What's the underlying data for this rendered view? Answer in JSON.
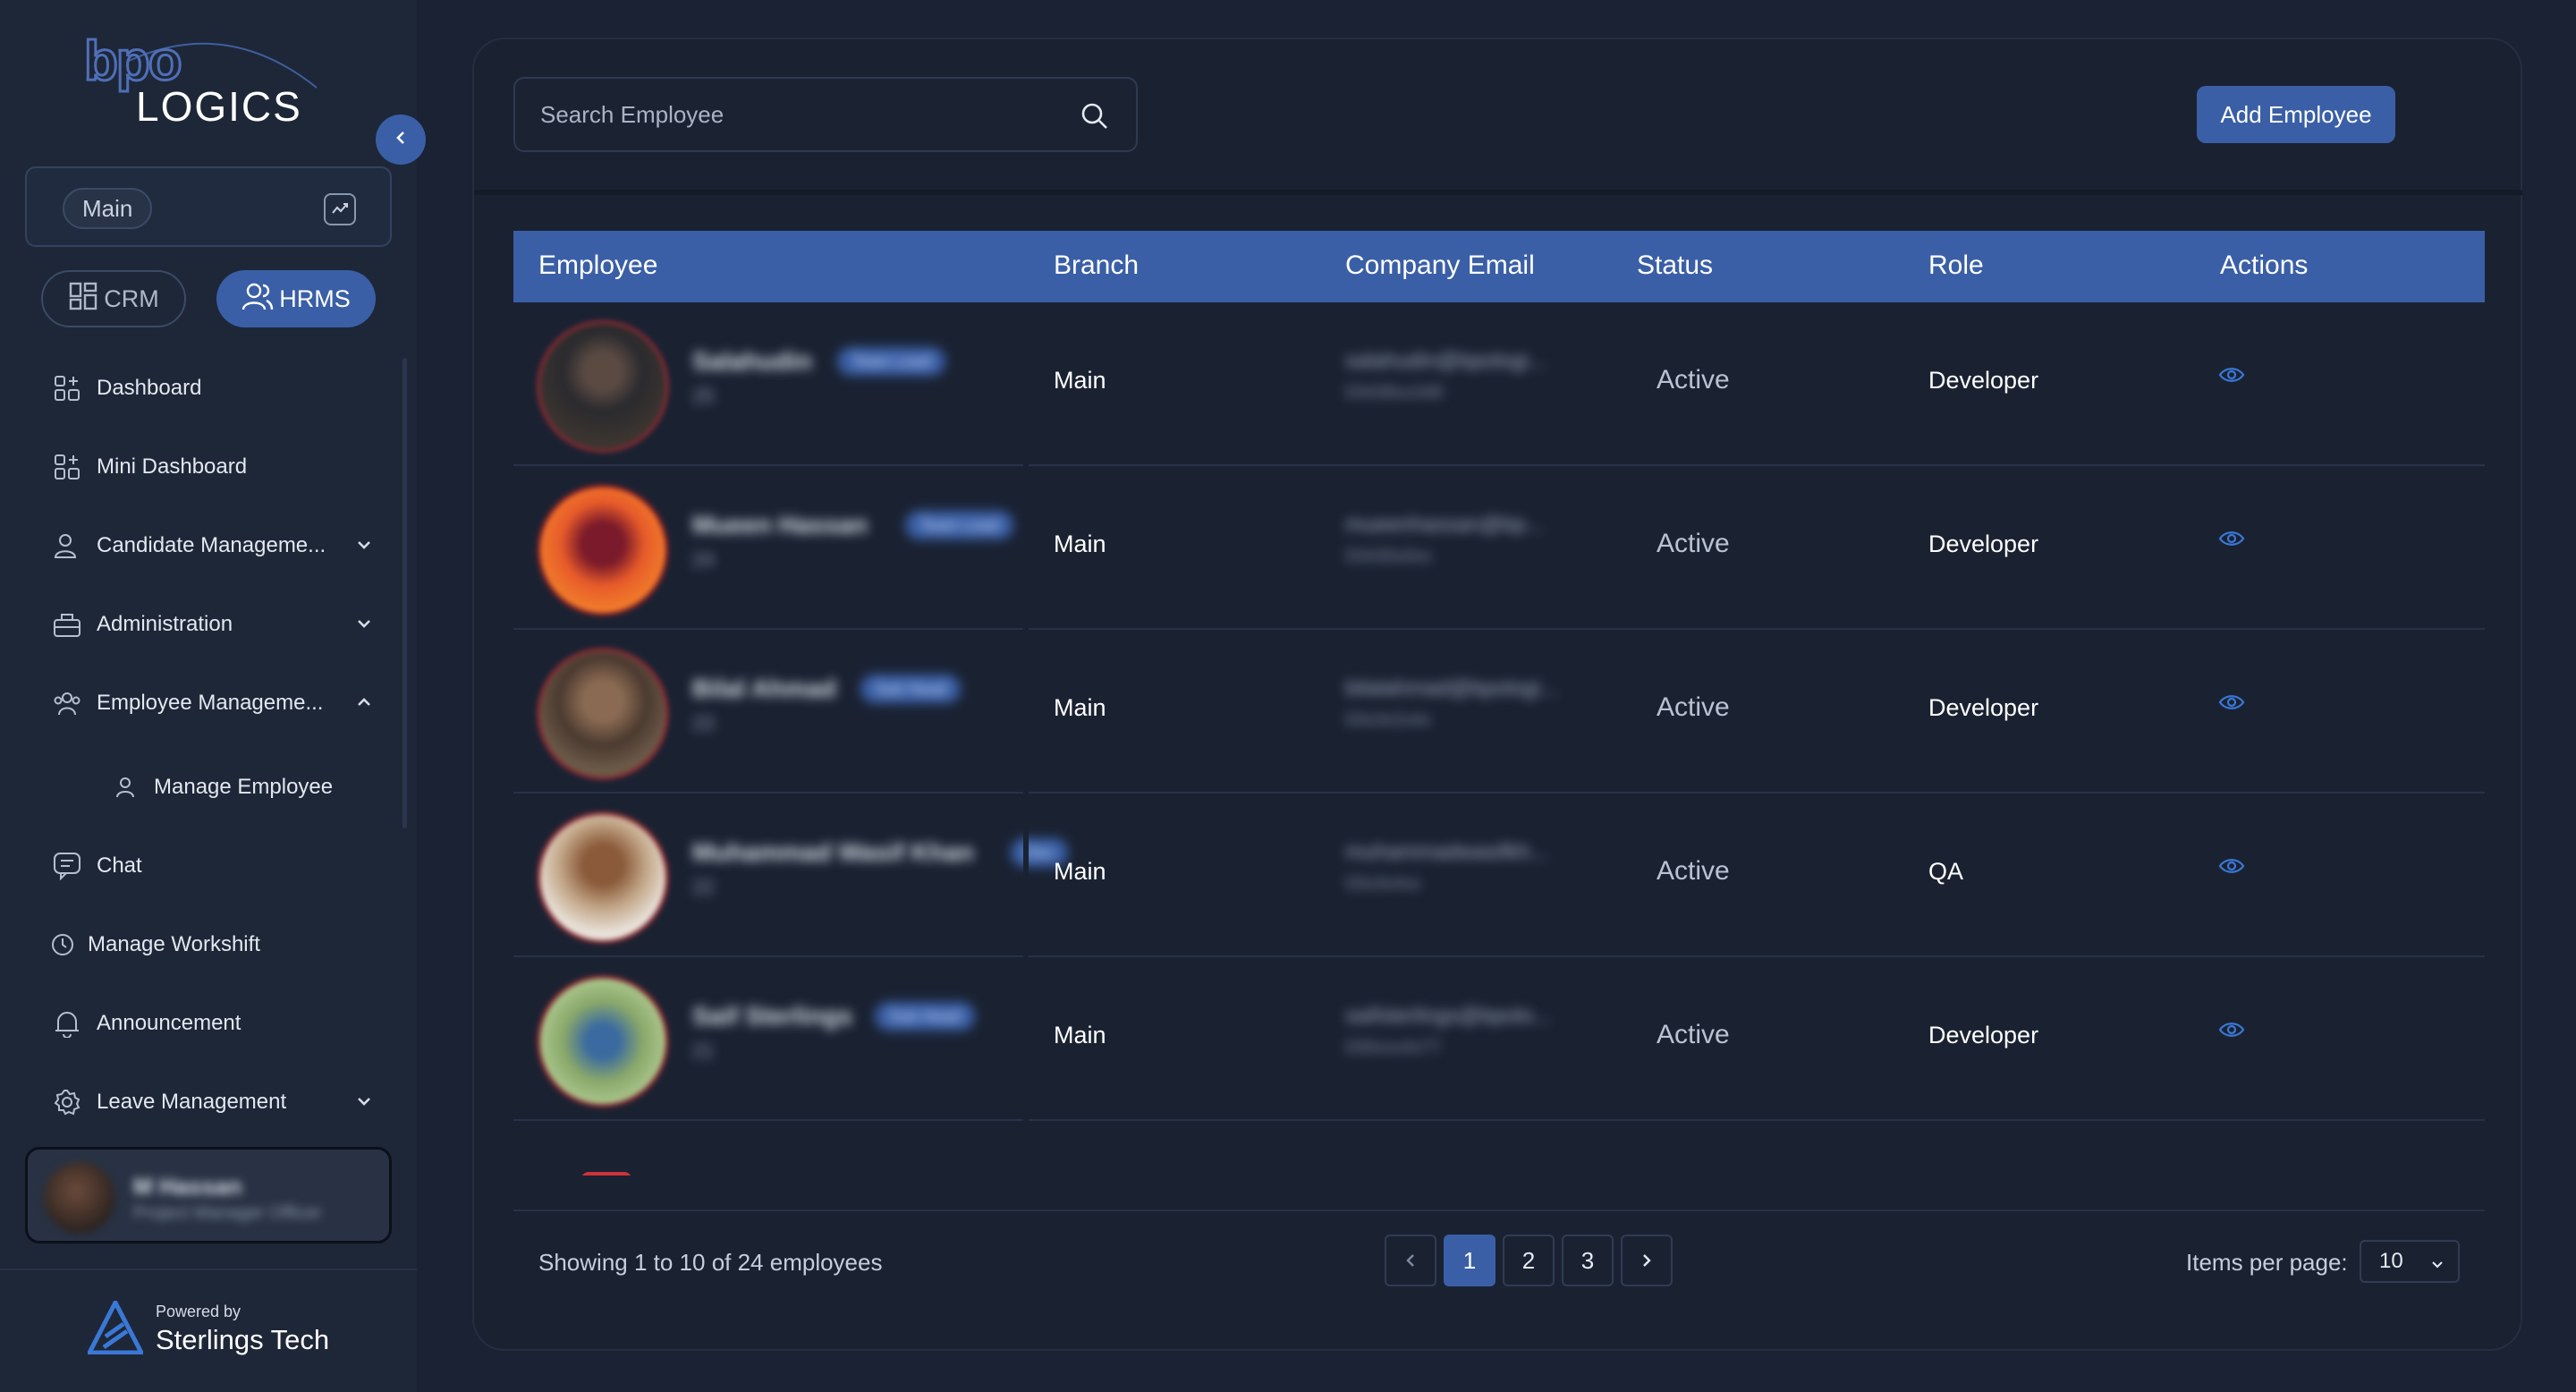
{
  "brand": {
    "top": "bpo",
    "bottom": "LOGICS"
  },
  "workspace": {
    "label": "Main"
  },
  "modules": {
    "crm": "CRM",
    "hrms": "HRMS"
  },
  "nav": [
    {
      "label": "Dashboard",
      "icon": "dashboard-icon"
    },
    {
      "label": "Mini Dashboard",
      "icon": "dashboard-icon"
    },
    {
      "label": "Candidate Manageme...",
      "icon": "users-icon",
      "expandable": true
    },
    {
      "label": "Administration",
      "icon": "briefcase-icon",
      "expandable": true
    },
    {
      "label": "Employee Manageme...",
      "icon": "team-icon",
      "expandable": true,
      "expanded": true
    },
    {
      "label": "Manage Employee",
      "icon": "user-icon",
      "sub": true
    },
    {
      "label": "Chat",
      "icon": "chat-icon"
    },
    {
      "label": "Manage Workshift",
      "icon": "clock-icon"
    },
    {
      "label": "Announcement",
      "icon": "bell-icon"
    },
    {
      "label": "Leave Management",
      "icon": "gear-icon",
      "expandable": true
    }
  ],
  "user": {
    "name": "M Hassan",
    "role": "Project Manager Officer"
  },
  "powered": {
    "label": "Powered by",
    "name": "Sterlings Tech"
  },
  "search": {
    "placeholder": "Search Employee"
  },
  "add_button": "Add Employee",
  "table": {
    "columns": [
      "Employee",
      "Branch",
      "Company Email",
      "Status",
      "Role",
      "Actions"
    ],
    "rows": [
      {
        "name": "Salahudin",
        "badge": "Team Lead",
        "id": "25",
        "branch": "Main",
        "email": "salahudin@bpologi...",
        "phone": "03438xx348",
        "status": "Active",
        "role": "Developer"
      },
      {
        "name": "Mueen Hassan",
        "badge": "Team Lead",
        "id": "24",
        "branch": "Main",
        "email": "mueenhassan@bp...",
        "phone": "03430x0xx",
        "status": "Active",
        "role": "Developer"
      },
      {
        "name": "Bilal Ahmad",
        "badge": "Sub Head",
        "id": "23",
        "branch": "Main",
        "email": "bilalahmad@bpologi...",
        "phone": "03x3x2x4x",
        "status": "Active",
        "role": "Developer"
      },
      {
        "name": "Muhammad Wasif Khan",
        "badge": "Dev",
        "id": "22",
        "branch": "Main",
        "email": "muhammadwasifkh...",
        "phone": "03x3x4xx",
        "status": "Active",
        "role": "QA"
      },
      {
        "name": "Saif Sterlings",
        "badge": "Sub Head",
        "id": "21",
        "branch": "Main",
        "email": "saifsterlings@bpolo...",
        "phone": "030xxx4x77",
        "status": "Active",
        "role": "Developer"
      }
    ]
  },
  "footer": {
    "showing": "Showing 1 to 10 of 24 employees",
    "pages": [
      "1",
      "2",
      "3"
    ],
    "current_page": "1",
    "items_per_page_label": "Items per page:",
    "items_per_page": "10"
  },
  "colors": {
    "accent": "#3a5fa6",
    "background": "#1a2233",
    "sidebar": "#1e2738"
  }
}
